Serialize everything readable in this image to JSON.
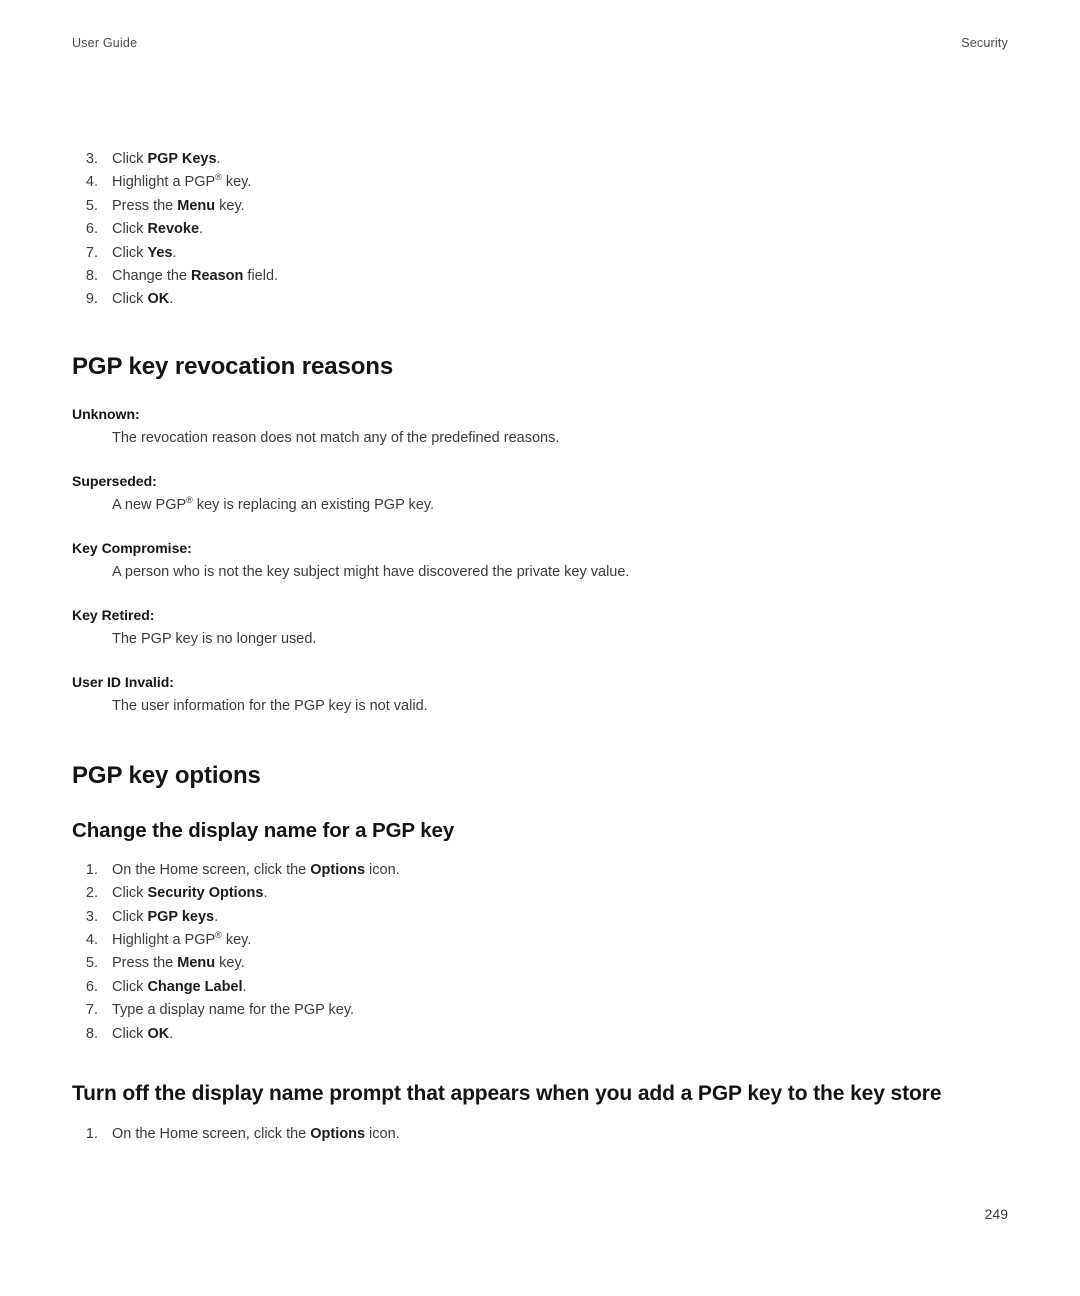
{
  "header": {
    "left": "User Guide",
    "right": "Security"
  },
  "steps_revoke": [
    {
      "num": "3.",
      "pre": "Click ",
      "bold": "PGP Keys",
      "post": "."
    },
    {
      "num": "4.",
      "pre": "Highlight a PGP",
      "reg": "®",
      "post": " key."
    },
    {
      "num": "5.",
      "pre": "Press the ",
      "bold": "Menu",
      "post": " key."
    },
    {
      "num": "6.",
      "pre": "Click ",
      "bold": "Revoke",
      "post": "."
    },
    {
      "num": "7.",
      "pre": "Click ",
      "bold": "Yes",
      "post": "."
    },
    {
      "num": "8.",
      "pre": "Change the ",
      "bold": "Reason",
      "post": " field."
    },
    {
      "num": "9.",
      "pre": "Click ",
      "bold": "OK",
      "post": "."
    }
  ],
  "heading_reasons": "PGP key revocation reasons",
  "reasons": [
    {
      "term": "Unknown:",
      "desc": "The revocation reason does not match any of the predefined reasons."
    },
    {
      "term": "Superseded:",
      "desc_pre": "A new PGP",
      "desc_reg": "®",
      "desc_post": " key is replacing an existing PGP key."
    },
    {
      "term": "Key Compromise:",
      "desc": "A person who is not the key subject might have discovered the private key value."
    },
    {
      "term": "Key Retired:",
      "desc": "The PGP key is no longer used."
    },
    {
      "term": "User ID Invalid:",
      "desc": "The user information for the PGP key is not valid."
    }
  ],
  "heading_options": "PGP key options",
  "heading_change_name": "Change the display name for a PGP key",
  "steps_change_name": [
    {
      "num": "1.",
      "pre": "On the Home screen, click the ",
      "bold": "Options",
      "post": " icon."
    },
    {
      "num": "2.",
      "pre": "Click ",
      "bold": "Security Options",
      "post": "."
    },
    {
      "num": "3.",
      "pre": "Click ",
      "bold": "PGP keys",
      "post": "."
    },
    {
      "num": "4.",
      "pre": "Highlight a PGP",
      "reg": "®",
      "post": " key."
    },
    {
      "num": "5.",
      "pre": "Press the ",
      "bold": "Menu",
      "post": " key."
    },
    {
      "num": "6.",
      "pre": "Click ",
      "bold": "Change Label",
      "post": "."
    },
    {
      "num": "7.",
      "pre": "Type a display name for the PGP key.",
      "post": ""
    },
    {
      "num": "8.",
      "pre": "Click ",
      "bold": "OK",
      "post": "."
    }
  ],
  "heading_turn_off": "Turn off the display name prompt that appears when you add a PGP key to the key store",
  "steps_turn_off": [
    {
      "num": "1.",
      "pre": "On the Home screen, click the ",
      "bold": "Options",
      "post": " icon."
    }
  ],
  "folio": "249"
}
